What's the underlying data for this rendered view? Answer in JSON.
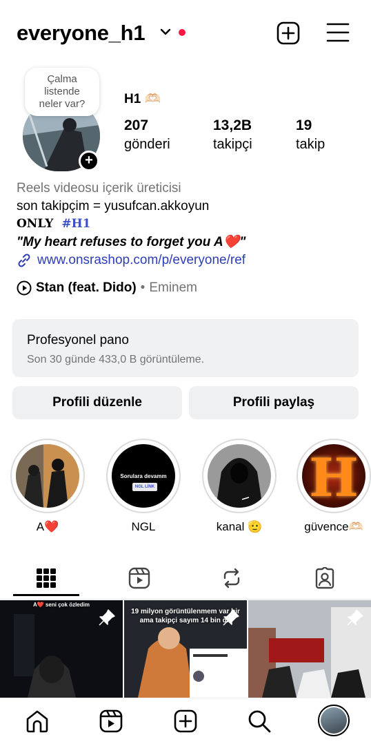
{
  "header": {
    "username": "everyone_h1"
  },
  "note": {
    "line1": "Çalma",
    "line2": "listende",
    "line3": "neler var?"
  },
  "profile": {
    "display_name": "H1 🫶🏻",
    "posts_count": "207",
    "posts_label": "gönderi",
    "followers_count": "13,2B",
    "followers_label": "takipçi",
    "following_count": "19",
    "following_label": "takip"
  },
  "bio": {
    "category": "Reels videosu içerik üreticisi",
    "line1": "son takipçim = yusufcan.akkoyun",
    "only": "ONLY",
    "hashtag": "#H1",
    "quote": "\"My heart refuses to forget you  A❤️\"",
    "link": "www.onsrashop.com/p/everyone/ref"
  },
  "music": {
    "song": "Stan (feat. Dido)",
    "separator": "•",
    "artist": "Eminem"
  },
  "pro_panel": {
    "title": "Profesyonel pano",
    "subtitle": "Son 30 günde 433,0 B görüntüleme."
  },
  "buttons": {
    "edit": "Profili düzenle",
    "share": "Profili paylaş"
  },
  "highlights": [
    {
      "label": "A❤️"
    },
    {
      "label": "NGL",
      "overlay1": "Sorulara devamm",
      "overlay2": "NGL LİNK"
    },
    {
      "label": "kanal 🫡"
    },
    {
      "label": "güvence🫶🏻",
      "overlay": "H"
    }
  ],
  "grid": [
    {
      "caption": "A❤️ seni çok özledim"
    },
    {
      "caption": "19 milyon görüntülenmem var bir ama takipçi sayım 14 bin dır"
    },
    {
      "caption": ""
    }
  ],
  "colors": {
    "accent_link": "#2d3db5",
    "notification_dot": "#ff1744",
    "muted": "#737373"
  }
}
